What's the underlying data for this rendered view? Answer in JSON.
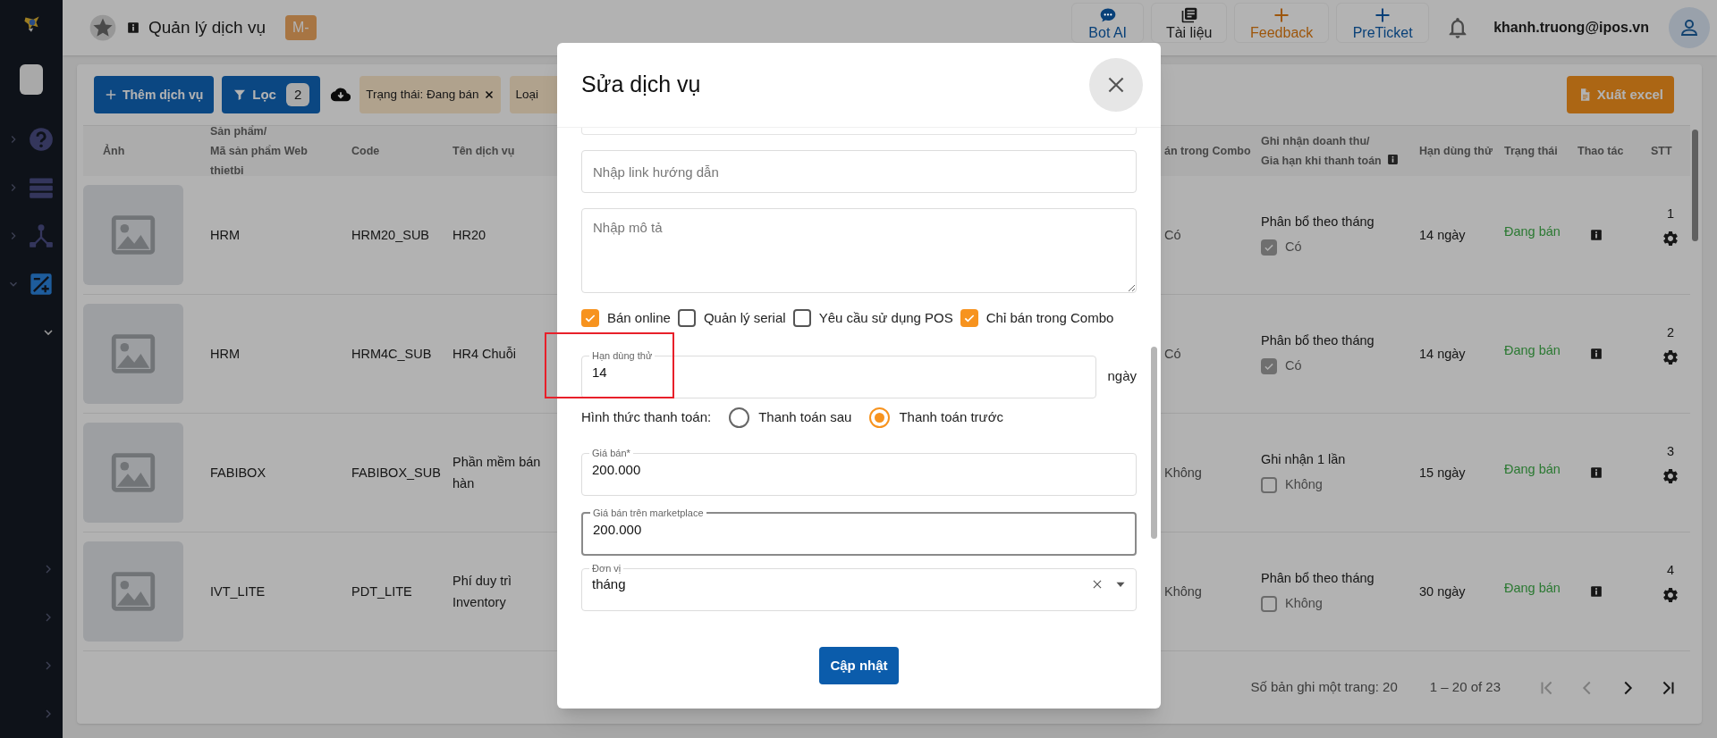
{
  "sidebar": {
    "items": [
      {
        "kind": "help",
        "expanded": false,
        "selected": false
      },
      {
        "kind": "list",
        "expanded": false,
        "selected": false
      },
      {
        "kind": "hierarchy",
        "expanded": false,
        "selected": false
      },
      {
        "kind": "edit",
        "expanded": true,
        "selected": true
      }
    ],
    "sub_items": [
      {
        "expanded": true
      },
      {
        "expanded": false
      },
      {
        "expanded": false
      },
      {
        "expanded": false
      },
      {
        "expanded": false
      }
    ]
  },
  "header": {
    "title": "Quản lý dịch vụ",
    "badge": "M-",
    "buttons": [
      {
        "kind": "chat",
        "label": "Bot AI",
        "color": "#084078"
      },
      {
        "kind": "book",
        "label": "Tài liệu",
        "color": "#181818"
      },
      {
        "kind": "plus",
        "label": "Feedback",
        "color": "#9d560b"
      },
      {
        "kind": "plus",
        "label": "PreTicket",
        "color": "#084078"
      }
    ],
    "user": "khanh.truong@ipos.vn"
  },
  "toolbar": {
    "add_button": "Thêm dịch vụ",
    "filter_button": {
      "label": "Lọc",
      "count": "2"
    },
    "chips": [
      {
        "label": "Trạng thái: Đang bán",
        "closable": true
      },
      {
        "label": "Loại"
      }
    ],
    "export_button": "Xuất excel"
  },
  "table": {
    "columns_left": [
      "Ảnh",
      "Sản phẩm/\nMã sản phẩm Web thietbi",
      "Code",
      "Tên dịch vụ"
    ],
    "columns_right": [
      "án trong Combo",
      "Ghi nhận doanh thu/\nGia hạn khi thanh toán",
      "Hạn dùng thử",
      "Trạng thái",
      "Thao tác",
      "STT"
    ],
    "rows": [
      {
        "product": "HRM",
        "code": "HRM20_SUB",
        "name": "HR20",
        "combo": "Có",
        "revenue": "Phân bổ theo tháng",
        "renew_checked": true,
        "renew_label": "Có",
        "trial": "14 ngày",
        "status": "Đang bán",
        "stt": "1"
      },
      {
        "product": "HRM",
        "code": "HRM4C_SUB",
        "name": "HR4 Chuỗi",
        "combo": "Có",
        "revenue": "Phân bổ theo tháng",
        "renew_checked": true,
        "renew_label": "Có",
        "trial": "14 ngày",
        "status": "Đang bán",
        "stt": "2"
      },
      {
        "product": "FABIBOX",
        "code": "FABIBOX_SUB",
        "name": "Phần mềm bán hàn",
        "combo": "Không",
        "revenue": "Ghi nhận 1 lần",
        "renew_checked": false,
        "renew_label": "Không",
        "trial": "15 ngày",
        "status": "Đang bán",
        "stt": "3"
      },
      {
        "product": "IVT_LITE",
        "code": "PDT_LITE",
        "name": "Phí duy trì Inventory",
        "combo": "Không",
        "revenue": "Phân bổ theo tháng",
        "renew_checked": false,
        "renew_label": "Không",
        "trial": "30 ngày",
        "status": "Đang bán",
        "stt": "4"
      }
    ]
  },
  "pagination": {
    "page_size": "Số bản ghi một trang: 20",
    "range": "1 – 20 of 23",
    "nav": [
      {
        "kind": "first",
        "disabled": true
      },
      {
        "kind": "prev",
        "disabled": true
      },
      {
        "kind": "next",
        "disabled": false
      },
      {
        "kind": "last",
        "disabled": false
      }
    ]
  },
  "modal": {
    "title": "Sửa dịch vụ",
    "link_field": {
      "placeholder": "Nhập link hướng dẫn"
    },
    "description_field": {
      "placeholder": "Nhập mô tả"
    },
    "checkboxes": [
      {
        "label": "Bán online",
        "checked": true
      },
      {
        "label": "Quản lý serial",
        "checked": false
      },
      {
        "label": "Yêu cầu sử dụng POS",
        "checked": false
      },
      {
        "label": "Chỉ bán trong Combo",
        "checked": true
      }
    ],
    "trial_field": {
      "label": "Hạn dùng thử",
      "value": "14",
      "suffix": "ngày",
      "highlighted": true
    },
    "payment": {
      "label": "Hình thức thanh toán:",
      "options": [
        {
          "label": "Thanh toán sau",
          "selected": false
        },
        {
          "label": "Thanh toán trước",
          "selected": true
        }
      ]
    },
    "price_fields": [
      {
        "label": "Giá bán*",
        "value": "200.000",
        "focused": false
      },
      {
        "label": "Giá bán trên marketplace",
        "value": "200.000",
        "focused": true
      }
    ],
    "unit_field": {
      "label": "Đơn vị",
      "value": "tháng"
    },
    "submit_button": "Cập nhật"
  }
}
